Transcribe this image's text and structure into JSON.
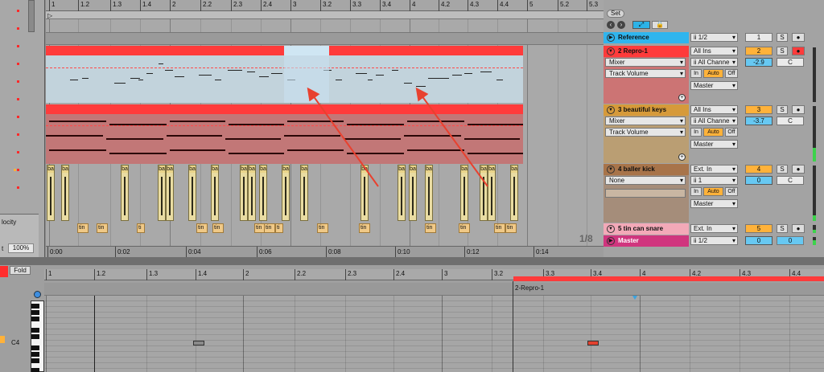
{
  "arrangement": {
    "ruler_ticks": [
      "1",
      "1.2",
      "1.3",
      "1.4",
      "2",
      "2.2",
      "2.3",
      "2.4",
      "3",
      "3.2",
      "3.3",
      "3.4",
      "4",
      "4.2",
      "4.3",
      "4.4",
      "5",
      "5.2",
      "5.3"
    ],
    "time_ticks": [
      "0:00",
      "0:02",
      "0:04",
      "0:06",
      "0:08",
      "0:10",
      "0:12",
      "0:14"
    ],
    "zoom_ratio": "1/8",
    "drum_clip_label": "ba",
    "snare_clip_labels": [
      "tin",
      "tin",
      "ti",
      "tin",
      "tin",
      "tin",
      "tin",
      "ti",
      "tin",
      "tin",
      "tin",
      "tin",
      "tin",
      "tin"
    ]
  },
  "left_panel": {
    "velocity_label": "locity",
    "tempo_label": "t",
    "percent_value": "100%"
  },
  "mixer": {
    "set_label": "Set",
    "tracks": [
      {
        "name": "Reference",
        "color": "#2fb5ee",
        "input": "ii 1/2",
        "number": "1",
        "solo": "S",
        "arm": "●"
      },
      {
        "name": "2 Repro-1",
        "color": "#ff3b3b",
        "input": "All Ins",
        "channel": "ii All Channe",
        "device": "Mixer",
        "param": "Track Volume",
        "mon_in": "In",
        "mon_auto": "Auto",
        "mon_off": "Off",
        "output": "Master",
        "number": "2",
        "solo": "S",
        "arm": "●",
        "volume": "-2.9",
        "pan": "C"
      },
      {
        "name": "3 beautiful keys",
        "color": "#d69a3a",
        "input": "All Ins",
        "channel": "ii All Channe",
        "device": "Mixer",
        "param": "Track Volume",
        "mon_in": "In",
        "mon_auto": "Auto",
        "mon_off": "Off",
        "output": "Master",
        "number": "3",
        "solo": "S",
        "arm": "●",
        "volume": "-3.7",
        "pan": "C"
      },
      {
        "name": "4 baller kick",
        "color": "#a8744a",
        "input": "Ext. In",
        "channel": "ii 1",
        "device": "None",
        "mon_in": "In",
        "mon_auto": "Auto",
        "mon_off": "Off",
        "output": "Master",
        "number": "4",
        "solo": "S",
        "arm": "●",
        "volume": "0",
        "pan": "C"
      },
      {
        "name": "5 tin can snare",
        "color": "#f3a9b8",
        "input": "Ext. In",
        "number": "5",
        "solo": "S",
        "arm": "●"
      },
      {
        "name": "Master",
        "color": "#d0357e",
        "input": "ii 1/2",
        "volume": "0",
        "pan": "0"
      }
    ]
  },
  "clip_view": {
    "fold_label": "Fold",
    "ruler_ticks": [
      "1",
      "1.2",
      "1.3",
      "1.4",
      "2",
      "2.2",
      "2.3",
      "2.4",
      "3",
      "3.2",
      "3.3",
      "3.4",
      "4",
      "4.2",
      "4.3",
      "4.4"
    ],
    "clip_name": "2-Repro-1",
    "key_label": "C4"
  },
  "colors": {
    "repro_clip": "#ff3b3b",
    "keys_clip": "#c47a7a",
    "kick_clip": "#e9dca2",
    "snare_clip": "#f0c987",
    "arrow": "#e8412f"
  }
}
